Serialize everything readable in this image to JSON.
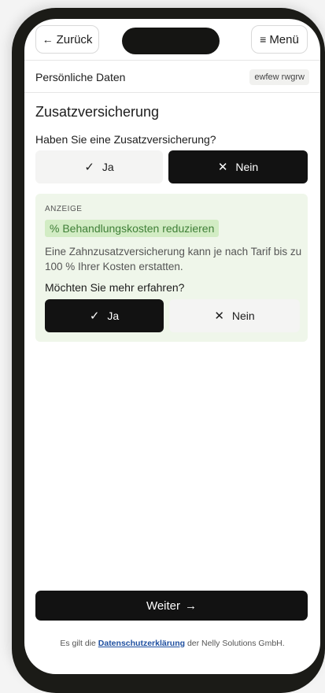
{
  "header": {
    "back_icon": "←",
    "back_label": "Zurück",
    "menu_icon": "≡",
    "menu_label": "Menü"
  },
  "section": {
    "title": "Persönliche Daten",
    "tag": "ewfew rwgrw"
  },
  "main": {
    "heading": "Zusatzversicherung",
    "question": "Haben Sie eine Zusatzversicherung?",
    "options": [
      {
        "label": "Ja",
        "icon": "✓",
        "icon_name": "check-icon",
        "selected": false
      },
      {
        "label": "Nein",
        "icon": "✕",
        "icon_name": "close-icon",
        "selected": true
      }
    ]
  },
  "ad": {
    "label": "ANZEIGE",
    "highlight": "% Behandlungskosten reduzieren",
    "text": "Eine Zahnzusatzversicherung kann je nach Tarif bis zu 100 % Ihrer Kosten erstatten.",
    "question": "Möchten Sie mehr erfahren?",
    "options": [
      {
        "label": "Ja",
        "icon": "✓",
        "icon_name": "check-icon",
        "selected": true
      },
      {
        "label": "Nein",
        "icon": "✕",
        "icon_name": "close-icon",
        "selected": false
      }
    ]
  },
  "footer": {
    "next_label": "Weiter",
    "next_icon": "→",
    "prefix": "Es gilt die",
    "link": "Datenschutzerklärung",
    "suffix": "der Nelly Solutions GmbH."
  },
  "colors": {
    "primary_dark": "#121212",
    "ad_background": "#eff6ea",
    "highlight_background": "#d2ecc4",
    "highlight_text": "#3f7f37",
    "link": "#1e4fa0"
  }
}
